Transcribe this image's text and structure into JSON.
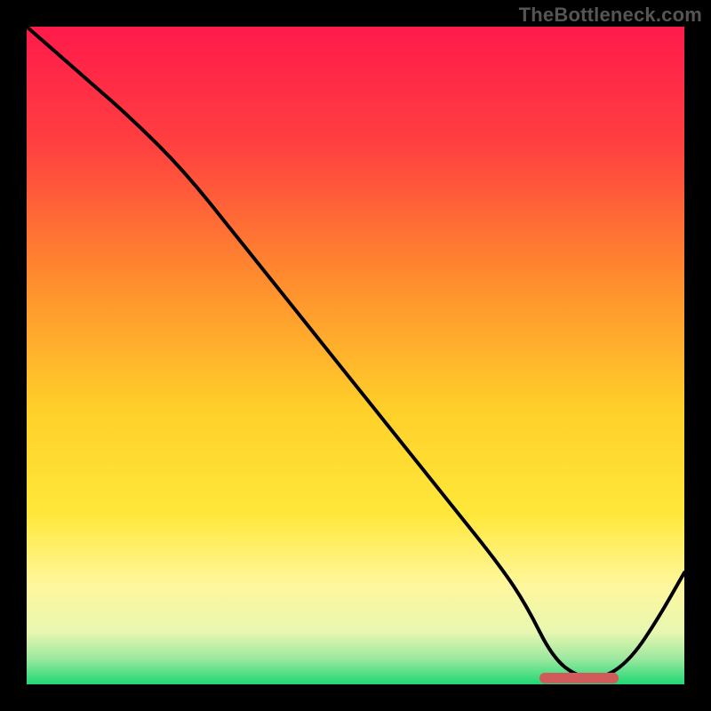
{
  "watermark": "TheBottleneck.com",
  "colors": {
    "top": "#ff1a4b",
    "mid_red_orange": "#ff6a3a",
    "mid_orange": "#ffa52e",
    "yellow": "#ffe330",
    "pale_yellow": "#fff9a8",
    "pale_green": "#c9f5a8",
    "green": "#22e07a",
    "curve": "#000000",
    "marker": "#d15a5a",
    "frame": "#000000"
  },
  "chart_data": {
    "type": "line",
    "title": "",
    "xlabel": "",
    "ylabel": "",
    "xlim": [
      0,
      100
    ],
    "ylim": [
      0,
      100
    ],
    "legend": false,
    "grid": false,
    "background": "red-to-green vertical gradient",
    "series": [
      {
        "name": "bottleneck-curve",
        "x": [
          0,
          8,
          16,
          24,
          32,
          40,
          48,
          56,
          64,
          72,
          76,
          80,
          84,
          88,
          92,
          96,
          100
        ],
        "values": [
          100,
          93,
          86,
          78,
          68,
          58,
          48,
          38,
          28,
          18,
          12,
          4,
          1,
          1,
          4,
          10,
          17
        ]
      }
    ],
    "marker_segment": {
      "x_start": 78,
      "x_end": 90,
      "y": 1,
      "color": "#d15a5a"
    },
    "annotations": [
      {
        "text": "TheBottleneck.com",
        "position": "top-right"
      }
    ]
  }
}
